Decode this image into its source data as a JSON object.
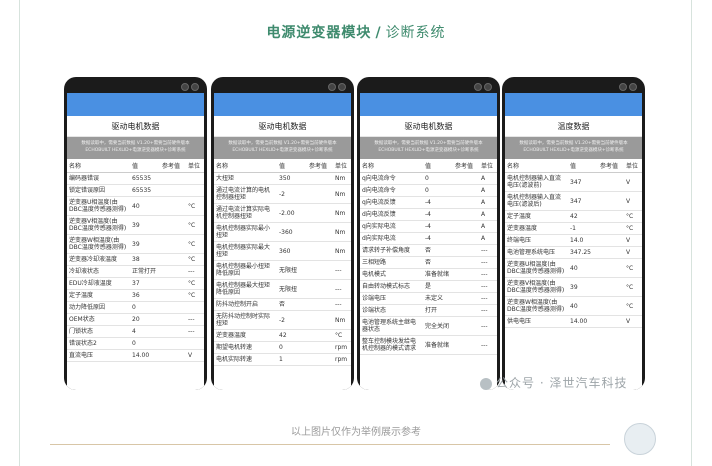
{
  "header": {
    "title": "电源逆变器模块",
    "separator": "/",
    "subtitle": "诊断系统"
  },
  "info_text": "数据读取中，需要当前数据 V1.20+需要当前硬件版本 ECHOBUILT HEXLID+电源逆变器模块+诊断系统",
  "columns": {
    "name": "名称",
    "value": "值",
    "ref": "参考值",
    "unit": "单位"
  },
  "phones": [
    {
      "title": "驱动电机数据",
      "rows": [
        {
          "name": "编码器错误",
          "value": "65535",
          "ref": "",
          "unit": ""
        },
        {
          "name": "锁定错误原因",
          "value": "65535",
          "ref": "",
          "unit": ""
        },
        {
          "name": "逆变器U相温度(由DBC温度传感器测得)",
          "value": "40",
          "ref": "",
          "unit": "°C"
        },
        {
          "name": "逆变器V相温度(由DBC温度传感器测得)",
          "value": "39",
          "ref": "",
          "unit": "°C"
        },
        {
          "name": "逆变器W相温度(由DBC温度传感器测得)",
          "value": "39",
          "ref": "",
          "unit": "°C"
        },
        {
          "name": "逆变器冷却液温度",
          "value": "38",
          "ref": "",
          "unit": "°C"
        },
        {
          "name": "冷却液状态",
          "value": "正常打开",
          "ref": "",
          "unit": "---"
        },
        {
          "name": "EDU冷却液温度",
          "value": "37",
          "ref": "",
          "unit": "°C"
        },
        {
          "name": "定子温度",
          "value": "36",
          "ref": "",
          "unit": "°C"
        },
        {
          "name": "动力降低原因",
          "value": "0",
          "ref": "",
          "unit": ""
        },
        {
          "name": "OEM状态",
          "value": "20",
          "ref": "",
          "unit": "---"
        },
        {
          "name": "门锁状态",
          "value": "4",
          "ref": "",
          "unit": "---"
        },
        {
          "name": "错误状态2",
          "value": "0",
          "ref": "",
          "unit": ""
        },
        {
          "name": "直流电压",
          "value": "14.00",
          "ref": "",
          "unit": "V"
        }
      ]
    },
    {
      "title": "驱动电机数据",
      "rows": [
        {
          "name": "大扭矩",
          "value": "350",
          "ref": "",
          "unit": "Nm"
        },
        {
          "name": "通过电流计算的电机控制器扭矩",
          "value": "-2",
          "ref": "",
          "unit": "Nm"
        },
        {
          "name": "通过电流计算实际电机控制器扭矩",
          "value": "-2.00",
          "ref": "",
          "unit": "Nm"
        },
        {
          "name": "电机控制器实际最小扭矩",
          "value": "-360",
          "ref": "",
          "unit": "Nm"
        },
        {
          "name": "电机控制器实际最大扭矩",
          "value": "360",
          "ref": "",
          "unit": "Nm"
        },
        {
          "name": "电机控制器最小扭矩降低原因",
          "value": "无限扭",
          "ref": "",
          "unit": "---"
        },
        {
          "name": "电机控制器最大扭矩降低原因",
          "value": "无限扭",
          "ref": "",
          "unit": "---"
        },
        {
          "name": "防抖动控制开启",
          "value": "否",
          "ref": "",
          "unit": "---"
        },
        {
          "name": "无防抖动控制时实际扭矩",
          "value": "-2",
          "ref": "",
          "unit": "Nm"
        },
        {
          "name": "逆变器温度",
          "value": "42",
          "ref": "",
          "unit": "°C"
        },
        {
          "name": "期望电机转速",
          "value": "0",
          "ref": "",
          "unit": "rpm"
        },
        {
          "name": "电机实际转速",
          "value": "1",
          "ref": "",
          "unit": "rpm"
        }
      ]
    },
    {
      "title": "驱动电机数据",
      "rows": [
        {
          "name": "q向电流命令",
          "value": "0",
          "ref": "",
          "unit": "A"
        },
        {
          "name": "d向电流命令",
          "value": "0",
          "ref": "",
          "unit": "A"
        },
        {
          "name": "q向电流反馈",
          "value": "-4",
          "ref": "",
          "unit": "A"
        },
        {
          "name": "d向电流反馈",
          "value": "-4",
          "ref": "",
          "unit": "A"
        },
        {
          "name": "q向实际电流",
          "value": "-4",
          "ref": "",
          "unit": "A"
        },
        {
          "name": "d向实际电流",
          "value": "-4",
          "ref": "",
          "unit": "A"
        },
        {
          "name": "请求转子补偿角度",
          "value": "否",
          "ref": "",
          "unit": "---"
        },
        {
          "name": "三相短路",
          "value": "否",
          "ref": "",
          "unit": "---"
        },
        {
          "name": "电机模式",
          "value": "准备就绪",
          "ref": "",
          "unit": "---"
        },
        {
          "name": "自由转动模式标志",
          "value": "是",
          "ref": "",
          "unit": "---"
        },
        {
          "name": "诊端电压",
          "value": "未定义",
          "ref": "",
          "unit": "---"
        },
        {
          "name": "诊端状态",
          "value": "打开",
          "ref": "",
          "unit": "---"
        },
        {
          "name": "电池管理系统主继电器状态",
          "value": "完全关闭",
          "ref": "",
          "unit": "---"
        },
        {
          "name": "整车控制模块发给电机控制器的模式请求",
          "value": "准备就绪",
          "ref": "",
          "unit": "---"
        }
      ]
    },
    {
      "title": "温度数据",
      "rows": [
        {
          "name": "电机控制器输入直流电压(滤波前)",
          "value": "347",
          "ref": "",
          "unit": "V"
        },
        {
          "name": "电机控制器输入直流电压(滤波后)",
          "value": "347",
          "ref": "",
          "unit": "V"
        },
        {
          "name": "定子温度",
          "value": "42",
          "ref": "",
          "unit": "°C"
        },
        {
          "name": "逆变器温度",
          "value": "-1",
          "ref": "",
          "unit": "°C"
        },
        {
          "name": "终端电压",
          "value": "14.0",
          "ref": "",
          "unit": "V"
        },
        {
          "name": "电池管理系统电压",
          "value": "347.25",
          "ref": "",
          "unit": "V"
        },
        {
          "name": "逆变器U相温度(由DBC温度传感器测得)",
          "value": "40",
          "ref": "",
          "unit": "°C"
        },
        {
          "name": "逆变器V相温度(由DBC温度传感器测得)",
          "value": "39",
          "ref": "",
          "unit": "°C"
        },
        {
          "name": "逆变器W相温度(由DBC温度传感器测得)",
          "value": "40",
          "ref": "",
          "unit": "°C"
        },
        {
          "name": "供电电压",
          "value": "14.00",
          "ref": "",
          "unit": "V"
        }
      ]
    }
  ],
  "watermark": "公众号 · 泽世汽车科技",
  "footer": "以上图片仅作为举例展示参考",
  "colors": {
    "accent": "#3f8b6e",
    "header_blue": "#4a90e2"
  }
}
